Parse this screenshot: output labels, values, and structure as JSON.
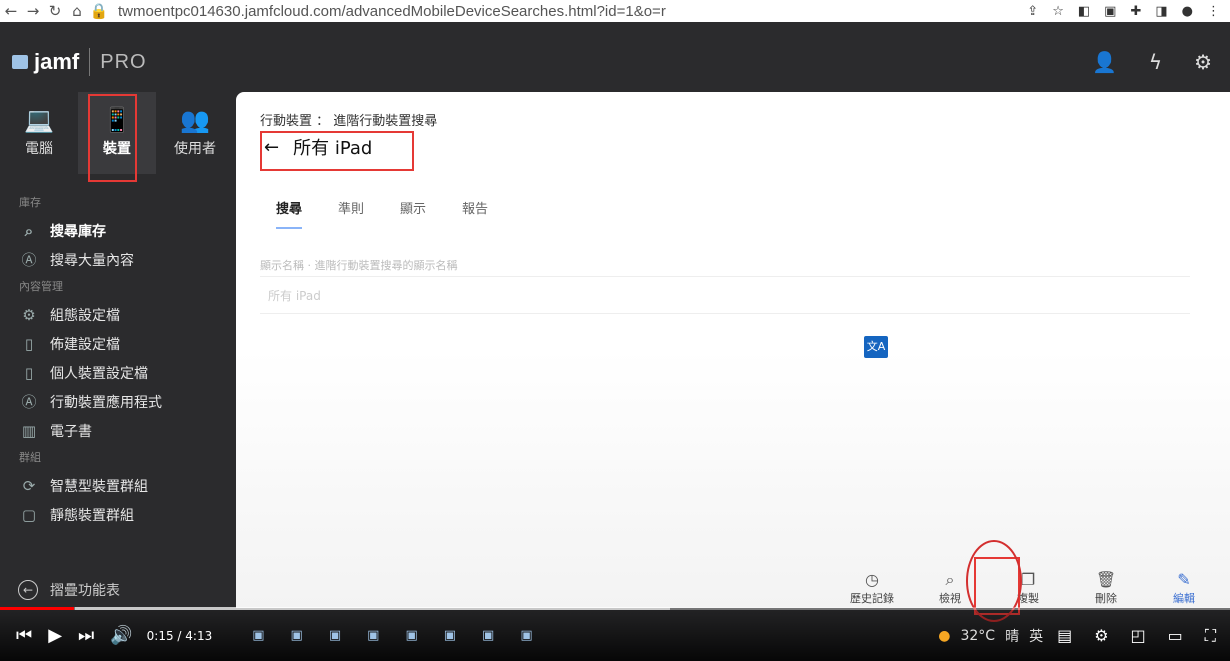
{
  "browser": {
    "url": "twmoentpc014630.jamfcloud.com/advancedMobileDeviceSearches.html?id=1&o=r"
  },
  "app": {
    "logo_name": "jamf",
    "logo_suffix": "PRO"
  },
  "categories": [
    {
      "label": "電腦",
      "icon": "laptop-icon"
    },
    {
      "label": "裝置",
      "icon": "mobile-device-icon",
      "active": true
    },
    {
      "label": "使用者",
      "icon": "users-icon"
    }
  ],
  "sidebar": {
    "sections": [
      {
        "title": "庫存",
        "items": [
          {
            "label": "搜尋庫存",
            "icon": "search-icon",
            "bold": true
          },
          {
            "label": "搜尋大量內容",
            "icon": "app-store-icon"
          }
        ]
      },
      {
        "title": "內容管理",
        "items": [
          {
            "label": "組態設定檔",
            "icon": "gear-icon"
          },
          {
            "label": "佈建設定檔",
            "icon": "document-icon"
          },
          {
            "label": "個人裝置設定檔",
            "icon": "personal-device-icon"
          },
          {
            "label": "行動裝置應用程式",
            "icon": "app-store-icon"
          },
          {
            "label": "電子書",
            "icon": "book-icon"
          }
        ]
      },
      {
        "title": "群組",
        "items": [
          {
            "label": "智慧型裝置群組",
            "icon": "smart-group-icon"
          },
          {
            "label": "靜態裝置群組",
            "icon": "static-group-icon"
          }
        ]
      }
    ],
    "collapse_label": "摺疊功能表"
  },
  "main": {
    "breadcrumb": "行動裝置 ： 進階行動裝置搜尋",
    "title": "所有 iPad",
    "tabs": [
      "搜尋",
      "準則",
      "顯示",
      "報告"
    ],
    "field_label": "顯示名稱 · 進階行動裝置搜尋的顯示名稱",
    "field_value": "所有 iPad",
    "translate_badge": "文A"
  },
  "actions": [
    {
      "label": "歷史記錄",
      "icon": "history-icon"
    },
    {
      "label": "檢視",
      "icon": "view-icon"
    },
    {
      "label": "複製",
      "icon": "copy-icon"
    },
    {
      "label": "刪除",
      "icon": "trash-icon"
    },
    {
      "label": "編輯",
      "icon": "edit-icon"
    }
  ],
  "player": {
    "time": "0:15 / 4:13",
    "progress_fraction": 0.06,
    "temperature": "32°C",
    "weather": "晴",
    "lang": "英"
  }
}
